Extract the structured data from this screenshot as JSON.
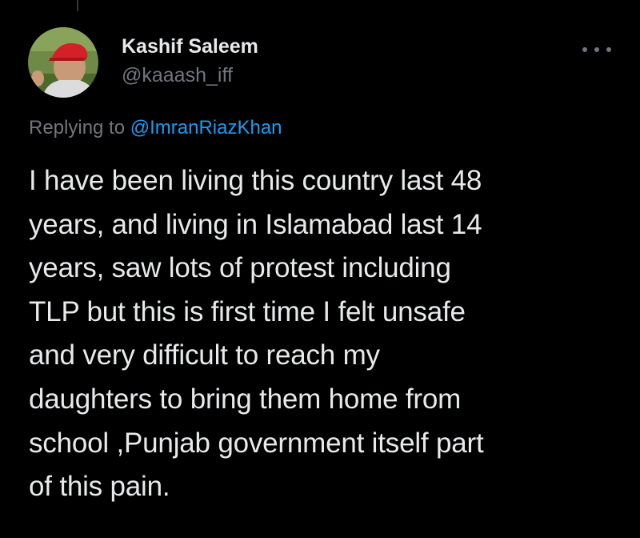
{
  "author": {
    "display_name": "Kashif Saleem",
    "handle": "@kaaash_iff"
  },
  "reply": {
    "prefix": "Replying to",
    "mention": "@ImranRiazKhan"
  },
  "tweet": {
    "lines": [
      "I have been living this country last 48",
      "years, and living in Islamabad last 14",
      "years, saw lots of protest including",
      "TLP but this is first time I felt unsafe",
      "and very difficult to reach my",
      "daughters to bring them home from",
      "school ,Punjab government itself part",
      "of this pain."
    ]
  },
  "icons": {
    "more": "more-options-icon"
  },
  "colors": {
    "background": "#000000",
    "primary_text": "#e7e9ea",
    "secondary_text": "#71767b",
    "link": "#1d9bf0"
  }
}
